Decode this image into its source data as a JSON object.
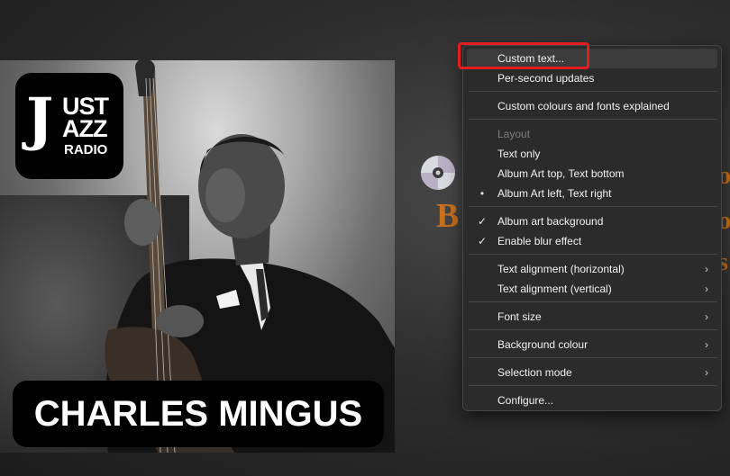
{
  "album": {
    "logo_line1": "UST",
    "logo_line2": "AZZ",
    "logo_line3": "RADIO",
    "logo_u": "J",
    "artist_banner": "CHARLES MINGUS"
  },
  "background_text": {
    "letter_b": "B",
    "partial_1": "o",
    "partial_2": "o",
    "partial_3": "s"
  },
  "menu": {
    "items": [
      {
        "label": "Custom text...",
        "state": "hover"
      },
      {
        "label": "Per-second updates"
      },
      {
        "label": "Custom colours and fonts explained"
      },
      {
        "label": "Layout",
        "state": "disabled"
      },
      {
        "label": "Text only"
      },
      {
        "label": "Album Art top, Text bottom"
      },
      {
        "label": "Album Art left, Text right",
        "mark": "•"
      },
      {
        "label": "Album art background",
        "mark": "✓"
      },
      {
        "label": "Enable blur effect",
        "mark": "✓"
      },
      {
        "label": "Text alignment (horizontal)",
        "submenu": "›"
      },
      {
        "label": "Text alignment (vertical)",
        "submenu": "›"
      },
      {
        "label": "Font size",
        "submenu": "›"
      },
      {
        "label": "Background colour",
        "submenu": "›"
      },
      {
        "label": "Selection mode",
        "submenu": "›"
      },
      {
        "label": "Configure..."
      }
    ]
  },
  "colors": {
    "highlight": "#e41e1e",
    "accent_text": "#c8701c",
    "menu_bg": "#2b2b2b"
  }
}
